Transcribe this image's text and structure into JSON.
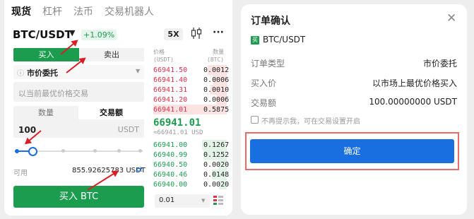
{
  "top_tabs": [
    "现货",
    "杠杆",
    "法币",
    "交易机器人"
  ],
  "pair": "BTC/USDT",
  "change": "+1.09%",
  "leverage": "5X",
  "side_tabs": {
    "buy": "买入",
    "sell": "卖出"
  },
  "order_type": "市价委托",
  "price_placeholder": "以当前最优价格交易",
  "amount_tabs": {
    "qty": "数量",
    "amount": "交易额"
  },
  "amount_value": "100",
  "amount_unit": "USDT",
  "available_label": "可用",
  "available_value": "855.92625783 USDT",
  "buy_button": "买入 BTC",
  "orderbook": {
    "price_header": "价格\n(USDT)",
    "qty_header": "数量\n(BTC)",
    "asks": [
      {
        "price": "66941.50",
        "qty": "0.0012"
      },
      {
        "price": "66941.40",
        "qty": "0.0006"
      },
      {
        "price": "66941.31",
        "qty": "0.0010"
      },
      {
        "price": "66941.20",
        "qty": "0.0006"
      },
      {
        "price": "66941.01",
        "qty": "0.5875"
      }
    ],
    "last_price": "66941.01",
    "last_price_usd": "≈66941.01 USD",
    "bids": [
      {
        "price": "66941.00",
        "qty": "0.1267"
      },
      {
        "price": "66940.99",
        "qty": "0.1252"
      },
      {
        "price": "66940.50",
        "qty": "0.0020"
      },
      {
        "price": "66940.46",
        "qty": "0.0148"
      },
      {
        "price": "66940.00",
        "qty": "0.0020"
      }
    ],
    "precision": "0.01"
  },
  "confirm": {
    "title": "订单确认",
    "pair": "BTC/USDT",
    "badge": "买",
    "rows": [
      {
        "label": "订单类型",
        "value": "市价委托"
      },
      {
        "label": "买入价",
        "value": "以市场上最优价格买入"
      },
      {
        "label": "交易额",
        "value": "100.00000000 USDT"
      }
    ],
    "checkbox_label": "不再提示我，可在交易设置开启",
    "confirm_button": "确定"
  },
  "colors": {
    "buy": "#1c9c4f",
    "sell": "#e0304a",
    "primary": "#1a6fe0",
    "highlight": "#e86a6a"
  }
}
